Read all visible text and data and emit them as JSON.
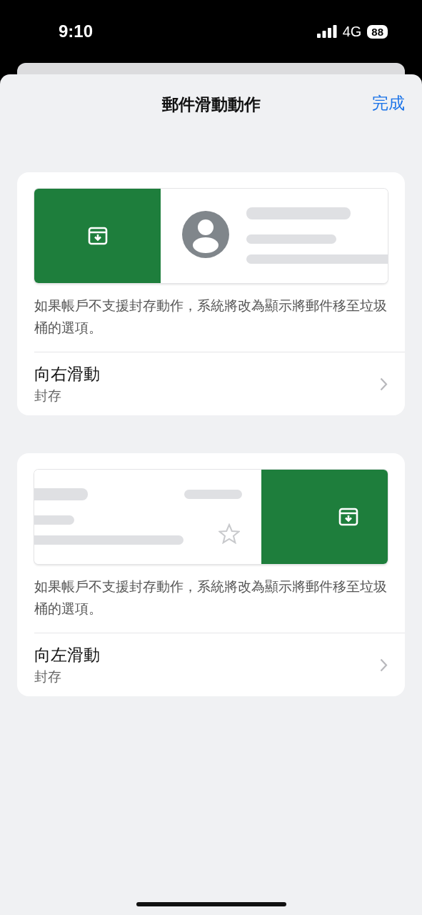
{
  "status_bar": {
    "time": "9:10",
    "network": "4G",
    "battery": "88"
  },
  "header": {
    "title": "郵件滑動動作",
    "done_button": "完成"
  },
  "cards": [
    {
      "kind": "right",
      "note": "如果帳戶不支援封存動作，系統將改為顯示將郵件移至垃圾桶的選項。",
      "setting": {
        "label": "向右滑動",
        "value": "封存"
      }
    },
    {
      "kind": "left",
      "note": "如果帳戶不支援封存動作，系統將改為顯示將郵件移至垃圾桶的選項。",
      "setting": {
        "label": "向左滑動",
        "value": "封存"
      }
    }
  ]
}
